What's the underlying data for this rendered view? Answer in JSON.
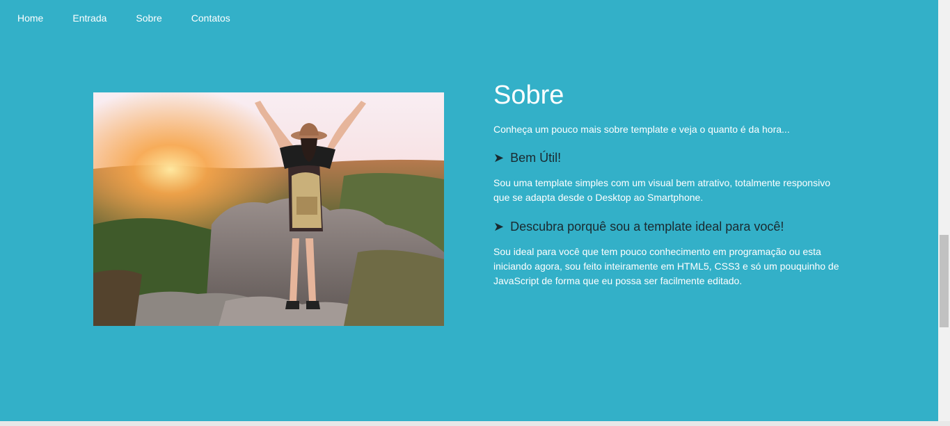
{
  "nav": {
    "items": [
      {
        "label": "Home"
      },
      {
        "label": "Entrada"
      },
      {
        "label": "Sobre"
      },
      {
        "label": "Contatos"
      }
    ]
  },
  "about": {
    "title": "Sobre",
    "intro": "Conheça um pouco mais sobre template e veja o quanto é da hora...",
    "sections": [
      {
        "arrow": "➤",
        "heading": "Bem Útil!",
        "text": "Sou uma template simples com um visual bem atrativo, totalmente responsivo que se adapta desde o Desktop ao Smartphone."
      },
      {
        "arrow": "➤",
        "heading": "Descubra porquê sou a template ideal para você!",
        "text": "Sou ideal para você que tem pouco conhecimento em programação ou esta iniciando agora, sou feito inteiramente em HTML5, CSS3 e só um pouquinho de JavaScript de forma que eu possa ser facilmente editado."
      }
    ]
  },
  "colors": {
    "background": "#33b0c8",
    "text": "#ffffff",
    "subheading": "#1a2a30"
  }
}
